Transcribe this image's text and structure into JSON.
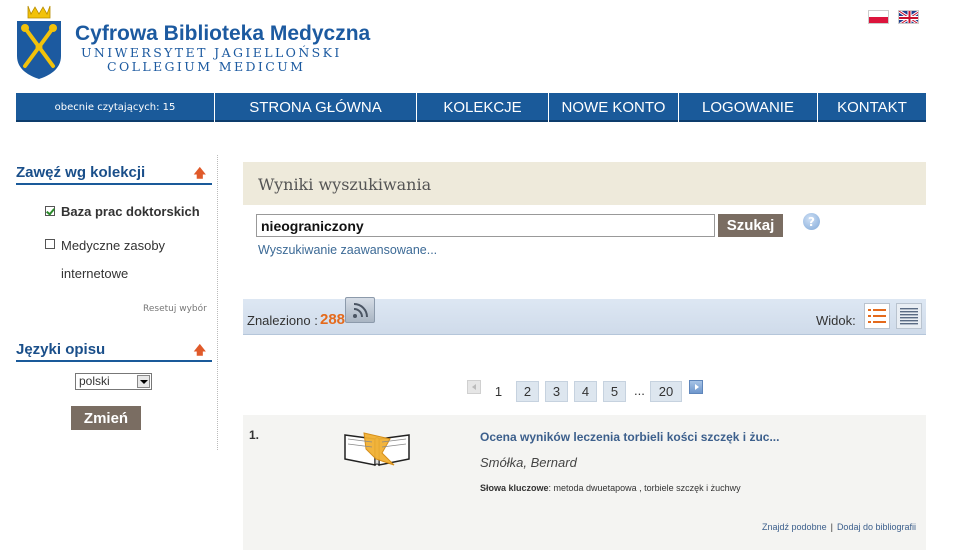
{
  "header": {
    "title": "Cyfrowa Biblioteka Medyczna",
    "subtitle1": "UNIWERSYTET JAGIELLOŃSKI",
    "subtitle2": "COLLEGIUM MEDICUM"
  },
  "nav": {
    "readers": "obecnie czytających: 15",
    "items": [
      "STRONA GŁÓWNA",
      "KOLEKCJE",
      "NOWE KONTO",
      "LOGOWANIE",
      "KONTAKT"
    ]
  },
  "sidebar": {
    "collections_heading": "Zawęź wg kolekcji",
    "collections": [
      {
        "label": "Baza prac doktorskich",
        "checked": true
      },
      {
        "label_line1": "Medyczne zasoby",
        "label_line2": "internetowe",
        "checked": false
      }
    ],
    "reset": "Resetuj wybór",
    "languages_heading": "Języki opisu",
    "language_selected": "polski",
    "change_button": "Zmień"
  },
  "main": {
    "results_title": "Wyniki wyszukiwania",
    "search_value": "nieograniczony",
    "search_button": "Szukaj",
    "advanced_link": "Wyszukiwanie zaawansowane...",
    "found_label": "Znaleziono :",
    "found_count": "288",
    "view_label": "Widok:"
  },
  "pagination": {
    "current": "1",
    "pages": [
      "2",
      "3",
      "4",
      "5"
    ],
    "ellipsis": "...",
    "last": "20"
  },
  "results": [
    {
      "number": "1.",
      "title": "Ocena wyników leczenia torbieli kości szczęk i żuc...",
      "author": "Smółka, Bernard",
      "keywords_label": "Słowa kluczowe",
      "keywords": ": metoda dwuetapowa , torbiele szczęk i żuchwy",
      "link_similar": "Znajdź podobne",
      "link_sep": "|",
      "link_bib": "Dodaj do bibliografii"
    }
  ],
  "colors": {
    "brand_blue": "#1a5a9a",
    "button_brown": "#7a6d62",
    "count_orange": "#e46a1c"
  }
}
